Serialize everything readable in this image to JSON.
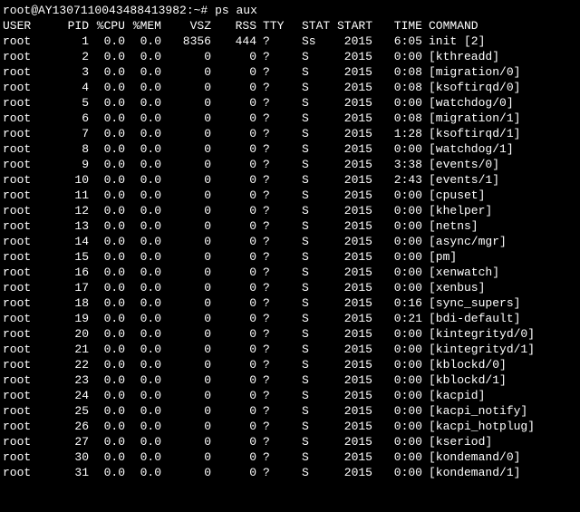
{
  "prompt": {
    "user_host": "root@AY1307110043488413982:~#",
    "command": "ps aux"
  },
  "headers": {
    "user": "USER",
    "pid": "PID",
    "cpu": "%CPU",
    "mem": "%MEM",
    "vsz": "VSZ",
    "rss": "RSS",
    "tty": "TTY",
    "stat": "STAT",
    "start": "START",
    "time": "TIME",
    "command": "COMMAND"
  },
  "rows": [
    {
      "user": "root",
      "pid": "1",
      "cpu": "0.0",
      "mem": "0.0",
      "vsz": "8356",
      "rss": "444",
      "tty": "?",
      "stat": "Ss",
      "start": "2015",
      "time": "6:05",
      "command": "init [2]"
    },
    {
      "user": "root",
      "pid": "2",
      "cpu": "0.0",
      "mem": "0.0",
      "vsz": "0",
      "rss": "0",
      "tty": "?",
      "stat": "S",
      "start": "2015",
      "time": "0:00",
      "command": "[kthreadd]"
    },
    {
      "user": "root",
      "pid": "3",
      "cpu": "0.0",
      "mem": "0.0",
      "vsz": "0",
      "rss": "0",
      "tty": "?",
      "stat": "S",
      "start": "2015",
      "time": "0:08",
      "command": "[migration/0]"
    },
    {
      "user": "root",
      "pid": "4",
      "cpu": "0.0",
      "mem": "0.0",
      "vsz": "0",
      "rss": "0",
      "tty": "?",
      "stat": "S",
      "start": "2015",
      "time": "0:08",
      "command": "[ksoftirqd/0]"
    },
    {
      "user": "root",
      "pid": "5",
      "cpu": "0.0",
      "mem": "0.0",
      "vsz": "0",
      "rss": "0",
      "tty": "?",
      "stat": "S",
      "start": "2015",
      "time": "0:00",
      "command": "[watchdog/0]"
    },
    {
      "user": "root",
      "pid": "6",
      "cpu": "0.0",
      "mem": "0.0",
      "vsz": "0",
      "rss": "0",
      "tty": "?",
      "stat": "S",
      "start": "2015",
      "time": "0:08",
      "command": "[migration/1]"
    },
    {
      "user": "root",
      "pid": "7",
      "cpu": "0.0",
      "mem": "0.0",
      "vsz": "0",
      "rss": "0",
      "tty": "?",
      "stat": "S",
      "start": "2015",
      "time": "1:28",
      "command": "[ksoftirqd/1]"
    },
    {
      "user": "root",
      "pid": "8",
      "cpu": "0.0",
      "mem": "0.0",
      "vsz": "0",
      "rss": "0",
      "tty": "?",
      "stat": "S",
      "start": "2015",
      "time": "0:00",
      "command": "[watchdog/1]"
    },
    {
      "user": "root",
      "pid": "9",
      "cpu": "0.0",
      "mem": "0.0",
      "vsz": "0",
      "rss": "0",
      "tty": "?",
      "stat": "S",
      "start": "2015",
      "time": "3:38",
      "command": "[events/0]"
    },
    {
      "user": "root",
      "pid": "10",
      "cpu": "0.0",
      "mem": "0.0",
      "vsz": "0",
      "rss": "0",
      "tty": "?",
      "stat": "S",
      "start": "2015",
      "time": "2:43",
      "command": "[events/1]"
    },
    {
      "user": "root",
      "pid": "11",
      "cpu": "0.0",
      "mem": "0.0",
      "vsz": "0",
      "rss": "0",
      "tty": "?",
      "stat": "S",
      "start": "2015",
      "time": "0:00",
      "command": "[cpuset]"
    },
    {
      "user": "root",
      "pid": "12",
      "cpu": "0.0",
      "mem": "0.0",
      "vsz": "0",
      "rss": "0",
      "tty": "?",
      "stat": "S",
      "start": "2015",
      "time": "0:00",
      "command": "[khelper]"
    },
    {
      "user": "root",
      "pid": "13",
      "cpu": "0.0",
      "mem": "0.0",
      "vsz": "0",
      "rss": "0",
      "tty": "?",
      "stat": "S",
      "start": "2015",
      "time": "0:00",
      "command": "[netns]"
    },
    {
      "user": "root",
      "pid": "14",
      "cpu": "0.0",
      "mem": "0.0",
      "vsz": "0",
      "rss": "0",
      "tty": "?",
      "stat": "S",
      "start": "2015",
      "time": "0:00",
      "command": "[async/mgr]"
    },
    {
      "user": "root",
      "pid": "15",
      "cpu": "0.0",
      "mem": "0.0",
      "vsz": "0",
      "rss": "0",
      "tty": "?",
      "stat": "S",
      "start": "2015",
      "time": "0:00",
      "command": "[pm]"
    },
    {
      "user": "root",
      "pid": "16",
      "cpu": "0.0",
      "mem": "0.0",
      "vsz": "0",
      "rss": "0",
      "tty": "?",
      "stat": "S",
      "start": "2015",
      "time": "0:00",
      "command": "[xenwatch]"
    },
    {
      "user": "root",
      "pid": "17",
      "cpu": "0.0",
      "mem": "0.0",
      "vsz": "0",
      "rss": "0",
      "tty": "?",
      "stat": "S",
      "start": "2015",
      "time": "0:00",
      "command": "[xenbus]"
    },
    {
      "user": "root",
      "pid": "18",
      "cpu": "0.0",
      "mem": "0.0",
      "vsz": "0",
      "rss": "0",
      "tty": "?",
      "stat": "S",
      "start": "2015",
      "time": "0:16",
      "command": "[sync_supers]"
    },
    {
      "user": "root",
      "pid": "19",
      "cpu": "0.0",
      "mem": "0.0",
      "vsz": "0",
      "rss": "0",
      "tty": "?",
      "stat": "S",
      "start": "2015",
      "time": "0:21",
      "command": "[bdi-default]"
    },
    {
      "user": "root",
      "pid": "20",
      "cpu": "0.0",
      "mem": "0.0",
      "vsz": "0",
      "rss": "0",
      "tty": "?",
      "stat": "S",
      "start": "2015",
      "time": "0:00",
      "command": "[kintegrityd/0]"
    },
    {
      "user": "root",
      "pid": "21",
      "cpu": "0.0",
      "mem": "0.0",
      "vsz": "0",
      "rss": "0",
      "tty": "?",
      "stat": "S",
      "start": "2015",
      "time": "0:00",
      "command": "[kintegrityd/1]"
    },
    {
      "user": "root",
      "pid": "22",
      "cpu": "0.0",
      "mem": "0.0",
      "vsz": "0",
      "rss": "0",
      "tty": "?",
      "stat": "S",
      "start": "2015",
      "time": "0:00",
      "command": "[kblockd/0]"
    },
    {
      "user": "root",
      "pid": "23",
      "cpu": "0.0",
      "mem": "0.0",
      "vsz": "0",
      "rss": "0",
      "tty": "?",
      "stat": "S",
      "start": "2015",
      "time": "0:00",
      "command": "[kblockd/1]"
    },
    {
      "user": "root",
      "pid": "24",
      "cpu": "0.0",
      "mem": "0.0",
      "vsz": "0",
      "rss": "0",
      "tty": "?",
      "stat": "S",
      "start": "2015",
      "time": "0:00",
      "command": "[kacpid]"
    },
    {
      "user": "root",
      "pid": "25",
      "cpu": "0.0",
      "mem": "0.0",
      "vsz": "0",
      "rss": "0",
      "tty": "?",
      "stat": "S",
      "start": "2015",
      "time": "0:00",
      "command": "[kacpi_notify]"
    },
    {
      "user": "root",
      "pid": "26",
      "cpu": "0.0",
      "mem": "0.0",
      "vsz": "0",
      "rss": "0",
      "tty": "?",
      "stat": "S",
      "start": "2015",
      "time": "0:00",
      "command": "[kacpi_hotplug]"
    },
    {
      "user": "root",
      "pid": "27",
      "cpu": "0.0",
      "mem": "0.0",
      "vsz": "0",
      "rss": "0",
      "tty": "?",
      "stat": "S",
      "start": "2015",
      "time": "0:00",
      "command": "[kseriod]"
    },
    {
      "user": "root",
      "pid": "30",
      "cpu": "0.0",
      "mem": "0.0",
      "vsz": "0",
      "rss": "0",
      "tty": "?",
      "stat": "S",
      "start": "2015",
      "time": "0:00",
      "command": "[kondemand/0]"
    },
    {
      "user": "root",
      "pid": "31",
      "cpu": "0.0",
      "mem": "0.0",
      "vsz": "0",
      "rss": "0",
      "tty": "?",
      "stat": "S",
      "start": "2015",
      "time": "0:00",
      "command": "[kondemand/1]"
    }
  ]
}
